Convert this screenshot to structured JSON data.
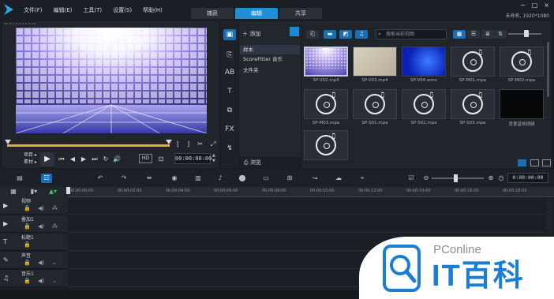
{
  "menu": [
    "文件(F)",
    "编辑(E)",
    "工具(T)",
    "设置(S)",
    "帮助(H)"
  ],
  "modes": [
    "捕获",
    "编辑",
    "共享"
  ],
  "active_mode": "编辑",
  "project_info": "未命名, 1920*1080",
  "player": {
    "mode_project": "项目 ▸",
    "mode_clip": "素材 ▸",
    "hd_label": "HD",
    "timecode": "00:00:00:00",
    "mark_in": "[",
    "mark_out": "]"
  },
  "folders": {
    "add_label": "添加",
    "items": [
      "样本",
      "ScoreFitter 音乐",
      "文件夹"
    ],
    "browse_label": "浏览"
  },
  "library": {
    "search_placeholder": "搜索当前视图",
    "items": [
      {
        "caption": "SP-V02.mp4",
        "kind": "video-disco",
        "selected": true
      },
      {
        "caption": "SP-V03.mp4",
        "kind": "video-beige",
        "selected": false
      },
      {
        "caption": "SP-V04.wmv",
        "kind": "video-blue",
        "selected": false
      },
      {
        "caption": "SP-M01.mpa",
        "kind": "music",
        "selected": false
      },
      {
        "caption": "SP-M02.mpa",
        "kind": "music",
        "selected": false
      },
      {
        "caption": "SP-M03.mpa",
        "kind": "music",
        "selected": false
      },
      {
        "caption": "SP-S01.mpa",
        "kind": "music",
        "selected": false
      },
      {
        "caption": "SP-S02.mpa",
        "kind": "music",
        "selected": false
      },
      {
        "caption": "SP-S03.mpa",
        "kind": "music",
        "selected": false
      },
      {
        "caption": "背景音效视频",
        "kind": "video-black",
        "selected": false
      },
      {
        "caption": "",
        "kind": "music",
        "selected": false
      }
    ]
  },
  "timeline": {
    "timecode": "0:00:00:00",
    "ticks": [
      "00:00:00:00",
      "00:00:02:00",
      "00:00:04:00",
      "00:00:06:00",
      "00:00:08:00",
      "00:00:10:00",
      "00:00:12:00",
      "00:00:14:00",
      "00:00:16:00",
      "00:00:18:00"
    ],
    "tracks": [
      {
        "name": "视频",
        "type": "video"
      },
      {
        "name": "叠加1",
        "type": "overlay"
      },
      {
        "name": "标题1",
        "type": "title"
      },
      {
        "name": "声音",
        "type": "voice"
      },
      {
        "name": "音乐1",
        "type": "music"
      }
    ]
  },
  "watermark": {
    "site": "PConline",
    "brand": "IT百科"
  },
  "colors": {
    "accent": "#1f8fd6",
    "scrub": "#e0b13a",
    "watermark_blue": "#1a7fd4"
  }
}
